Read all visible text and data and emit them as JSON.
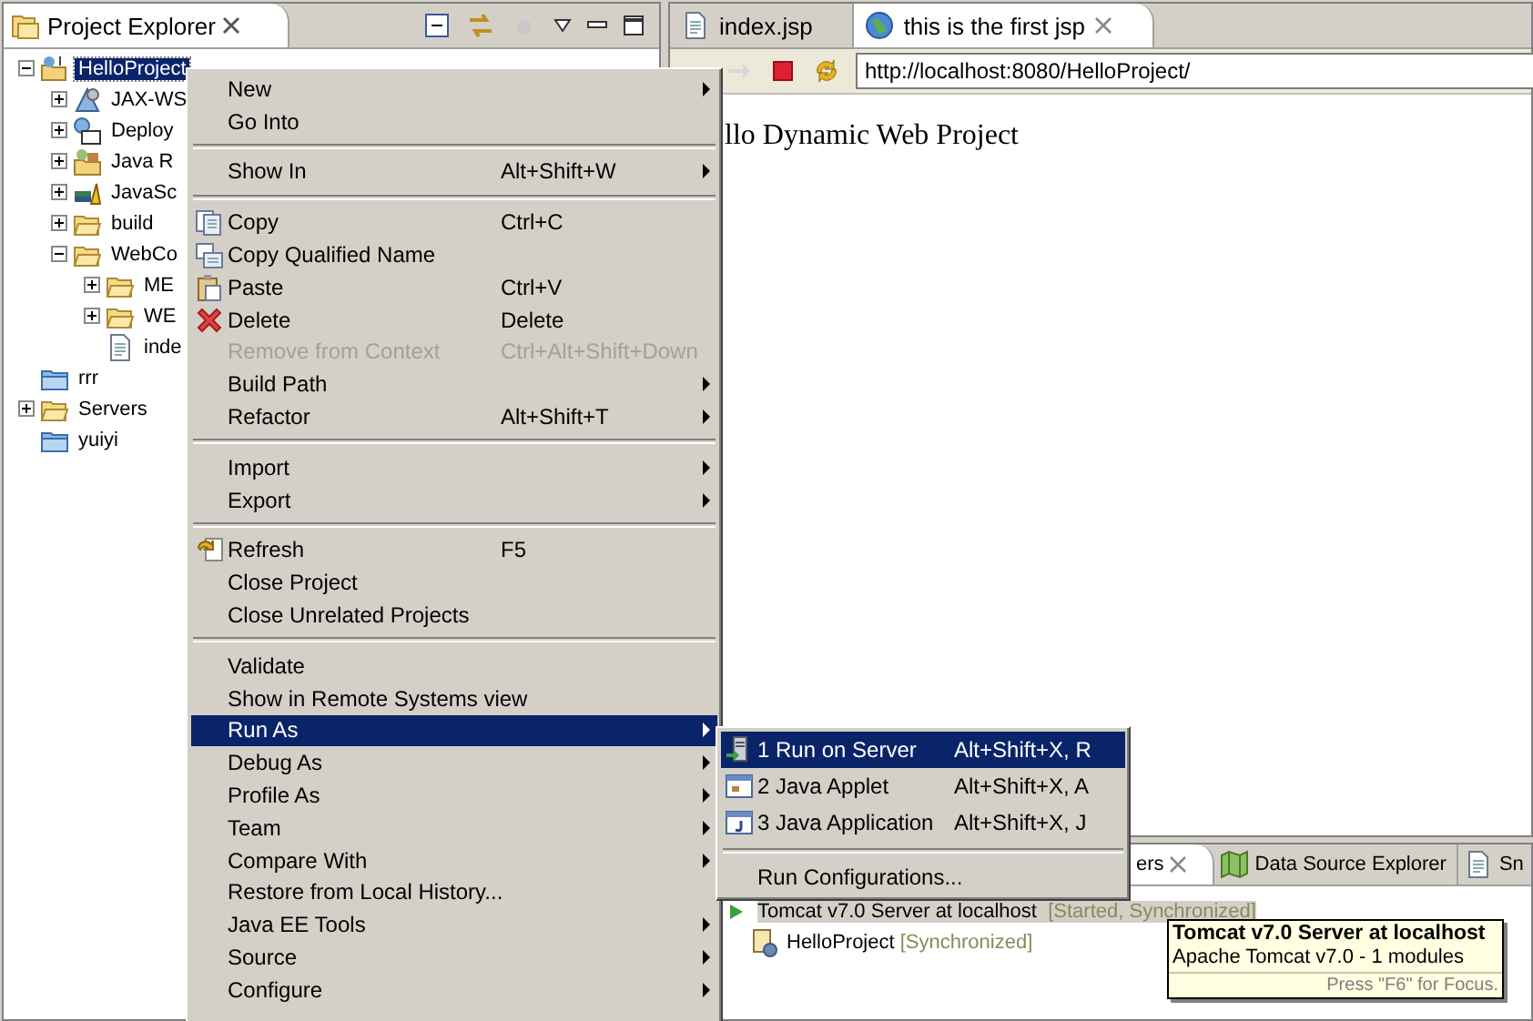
{
  "explorer": {
    "title": "Project Explorer",
    "tree": [
      {
        "label": "HelloProject",
        "kind": "project",
        "expanded": true,
        "selected": true,
        "children": [
          {
            "label": "JAX-WS",
            "kind": "service",
            "expanded": false
          },
          {
            "label": "Deploy",
            "kind": "deploy",
            "expanded": false
          },
          {
            "label": "Java R",
            "kind": "library",
            "expanded": false
          },
          {
            "label": "JavaSc",
            "kind": "js",
            "expanded": false
          },
          {
            "label": "build",
            "kind": "folder",
            "expanded": false
          },
          {
            "label": "WebCo",
            "kind": "folder",
            "expanded": true,
            "children": [
              {
                "label": "ME",
                "kind": "folder",
                "expanded": false
              },
              {
                "label": "WE",
                "kind": "folder",
                "expanded": false
              },
              {
                "label": "inde",
                "kind": "page"
              }
            ]
          }
        ]
      },
      {
        "label": "rrr",
        "kind": "blue-folder"
      },
      {
        "label": "Servers",
        "kind": "folder",
        "expanded": false
      },
      {
        "label": "yuiyi",
        "kind": "blue-folder"
      }
    ]
  },
  "editor": {
    "tabs": [
      {
        "label": "index.jsp",
        "kind": "page",
        "selected": false
      },
      {
        "label": "this is the first jsp",
        "kind": "globe",
        "selected": true
      }
    ],
    "url": "http://localhost:8080/HelloProject/",
    "content": "llo Dynamic Web Project"
  },
  "bottom_panel": {
    "tabs": [
      {
        "label": "ers",
        "kind": "plain",
        "selected": true
      },
      {
        "label": "Data Source Explorer",
        "kind": "map",
        "selected": false
      },
      {
        "label": "Sn",
        "kind": "page",
        "selected": false
      }
    ],
    "servers": [
      {
        "label": "Tomcat v7.0 Server at localhost",
        "status": "[Started, Synchronized]",
        "kind": "server",
        "selected": true,
        "children": [
          {
            "label": "HelloProject",
            "status": "[Synchronized]",
            "kind": "module",
            "selected": false
          }
        ]
      }
    ]
  },
  "context_menu": [
    {
      "kind": "item",
      "label": "New",
      "has_submenu": true
    },
    {
      "kind": "item",
      "label": "Go Into"
    },
    {
      "kind": "separator"
    },
    {
      "kind": "item",
      "label": "Show In",
      "shortcut": "Alt+Shift+W",
      "has_submenu": true
    },
    {
      "kind": "separator"
    },
    {
      "kind": "copy",
      "label": "Copy",
      "shortcut": "Ctrl+C"
    },
    {
      "kind": "copy-name",
      "label": "Copy Qualified Name"
    },
    {
      "kind": "paste",
      "label": "Paste",
      "shortcut": "Ctrl+V"
    },
    {
      "kind": "delete",
      "label": "Delete",
      "shortcut": "Delete"
    },
    {
      "kind": "item",
      "label": "Remove from Context",
      "shortcut": "Ctrl+Alt+Shift+Down",
      "disabled": true
    },
    {
      "kind": "item",
      "label": "Build Path",
      "has_submenu": true
    },
    {
      "kind": "item",
      "label": "Refactor",
      "shortcut": "Alt+Shift+T",
      "has_submenu": true
    },
    {
      "kind": "separator"
    },
    {
      "kind": "item",
      "label": "Import",
      "has_submenu": true
    },
    {
      "kind": "item",
      "label": "Export",
      "has_submenu": true
    },
    {
      "kind": "separator"
    },
    {
      "kind": "refresh",
      "label": "Refresh",
      "shortcut": "F5"
    },
    {
      "kind": "item",
      "label": "Close Project"
    },
    {
      "kind": "item",
      "label": "Close Unrelated Projects"
    },
    {
      "kind": "separator"
    },
    {
      "kind": "item",
      "label": "Validate"
    },
    {
      "kind": "item",
      "label": "Show in Remote Systems view"
    },
    {
      "kind": "item",
      "label": "Run As",
      "has_submenu": true,
      "selected": true
    },
    {
      "kind": "item",
      "label": "Debug As",
      "has_submenu": true
    },
    {
      "kind": "item",
      "label": "Profile As",
      "has_submenu": true
    },
    {
      "kind": "item",
      "label": "Team",
      "has_submenu": true
    },
    {
      "kind": "item",
      "label": "Compare With",
      "has_submenu": true
    },
    {
      "kind": "item",
      "label": "Restore from Local History..."
    },
    {
      "kind": "item",
      "label": "Java EE Tools",
      "has_submenu": true
    },
    {
      "kind": "item",
      "label": "Source",
      "has_submenu": true
    },
    {
      "kind": "item",
      "label": "Configure",
      "has_submenu": true
    }
  ],
  "run_as_submenu": [
    {
      "kind": "server",
      "label": "1 Run on Server",
      "shortcut": "Alt+Shift+X, R",
      "selected": true
    },
    {
      "kind": "applet",
      "label": "2 Java Applet",
      "shortcut": "Alt+Shift+X, A",
      "selected": false
    },
    {
      "kind": "app",
      "label": "3 Java Application",
      "shortcut": "Alt+Shift+X, J",
      "selected": false
    },
    {
      "kind": "separator"
    },
    {
      "kind": "item",
      "label": "Run Configurations...",
      "selected": false
    }
  ],
  "tooltip": {
    "title": "Tomcat v7.0 Server at localhost",
    "text": "Apache Tomcat v7.0 - 1 modules",
    "hint": "Press \"F6\" for Focus."
  }
}
